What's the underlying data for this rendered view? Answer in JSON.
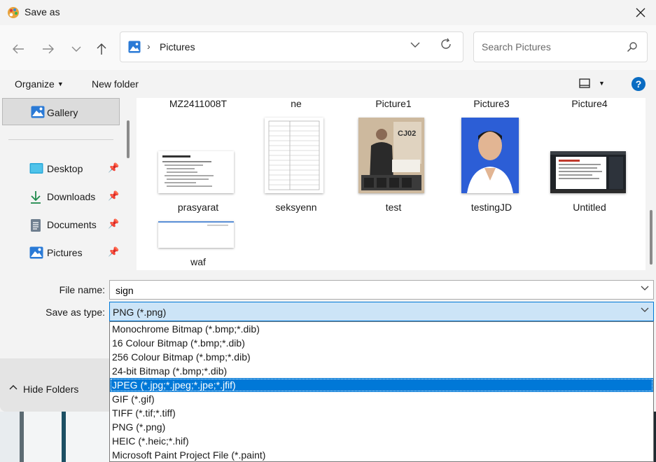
{
  "window": {
    "title": "Save as",
    "close_icon": "close-icon"
  },
  "nav": {
    "breadcrumb": "Pictures",
    "search_placeholder": "Search Pictures"
  },
  "toolbar": {
    "organize": "Organize",
    "new_folder": "New folder",
    "help": "?"
  },
  "sidebar": {
    "gallery": "Gallery",
    "items": [
      {
        "label": "Desktop",
        "icon": "desktop-icon"
      },
      {
        "label": "Downloads",
        "icon": "download-icon"
      },
      {
        "label": "Documents",
        "icon": "document-icon"
      },
      {
        "label": "Pictures",
        "icon": "picture-icon"
      }
    ]
  },
  "files": {
    "top_row": [
      "MZ2411008T",
      "ne",
      "Picture1",
      "Picture3",
      "Picture4"
    ],
    "row2": [
      "prasyarat",
      "seksyenn",
      "test",
      "testingJD",
      "Untitled"
    ],
    "row3": [
      "waf"
    ]
  },
  "form": {
    "file_name_label": "File name:",
    "file_name_value": "sign",
    "save_type_label": "Save as type:",
    "save_type_value": "PNG (*.png)",
    "hide_folders": "Hide Folders"
  },
  "type_options": [
    "Monochrome Bitmap (*.bmp;*.dib)",
    "16 Colour Bitmap (*.bmp;*.dib)",
    "256 Colour Bitmap (*.bmp;*.dib)",
    "24-bit Bitmap (*.bmp;*.dib)",
    "JPEG (*.jpg;*.jpeg;*.jpe;*.jfif)",
    "GIF (*.gif)",
    "TIFF (*.tif;*.tiff)",
    "PNG (*.png)",
    "HEIC (*.heic;*.hif)",
    "Microsoft Paint Project File (*.paint)"
  ],
  "selected_type_index": 4,
  "colors": {
    "accent": "#0078d7",
    "selection_bg": "#cce4f7"
  }
}
